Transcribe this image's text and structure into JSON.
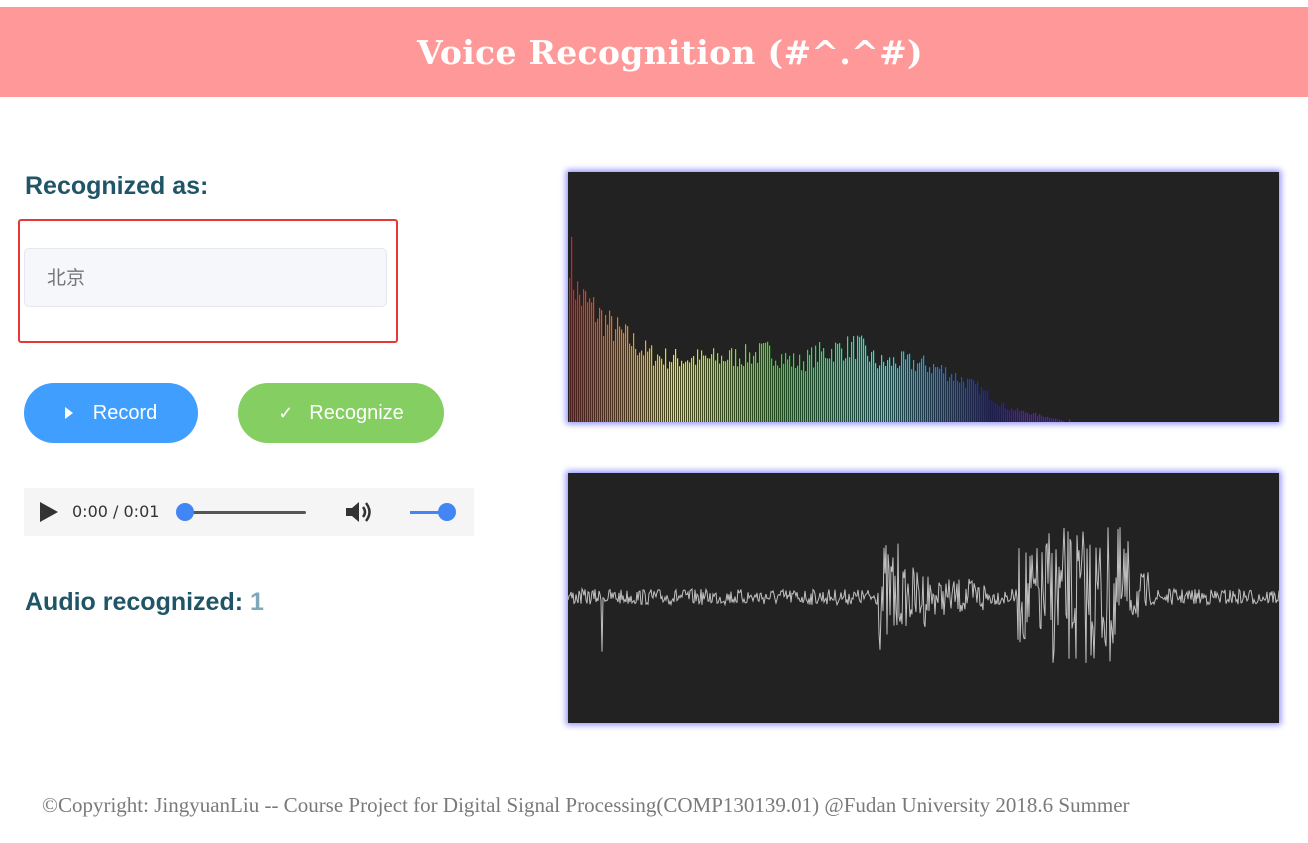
{
  "header": {
    "title": "Voice Recognition (#^.^#)"
  },
  "result": {
    "label": "Recognized as:",
    "placeholder": "北京"
  },
  "buttons": {
    "record_label": "Record",
    "recognize_label": "Recognize"
  },
  "audio_player": {
    "time": "0:00 / 0:01",
    "volume_level": 1.0,
    "progress": 0.0
  },
  "recognized_count": {
    "label": "Audio recognized:",
    "value": "1"
  },
  "visualizers": {
    "spectrum_name": "frequency-spectrum",
    "waveform_name": "waveform",
    "background": "#222222",
    "glow": "#8f8fff",
    "waveform_color": "#c0c0c0"
  },
  "footer": {
    "text": "©Copyright: JingyuanLiu -- Course Project for Digital Signal Processing(COMP130139.01) @Fudan University 2018.6 Summer"
  },
  "colors": {
    "header_bg": "#ff9999",
    "record": "#409eff",
    "recognize": "#85ce61",
    "heading": "#1f5566",
    "highlight_border": "#e53935"
  }
}
